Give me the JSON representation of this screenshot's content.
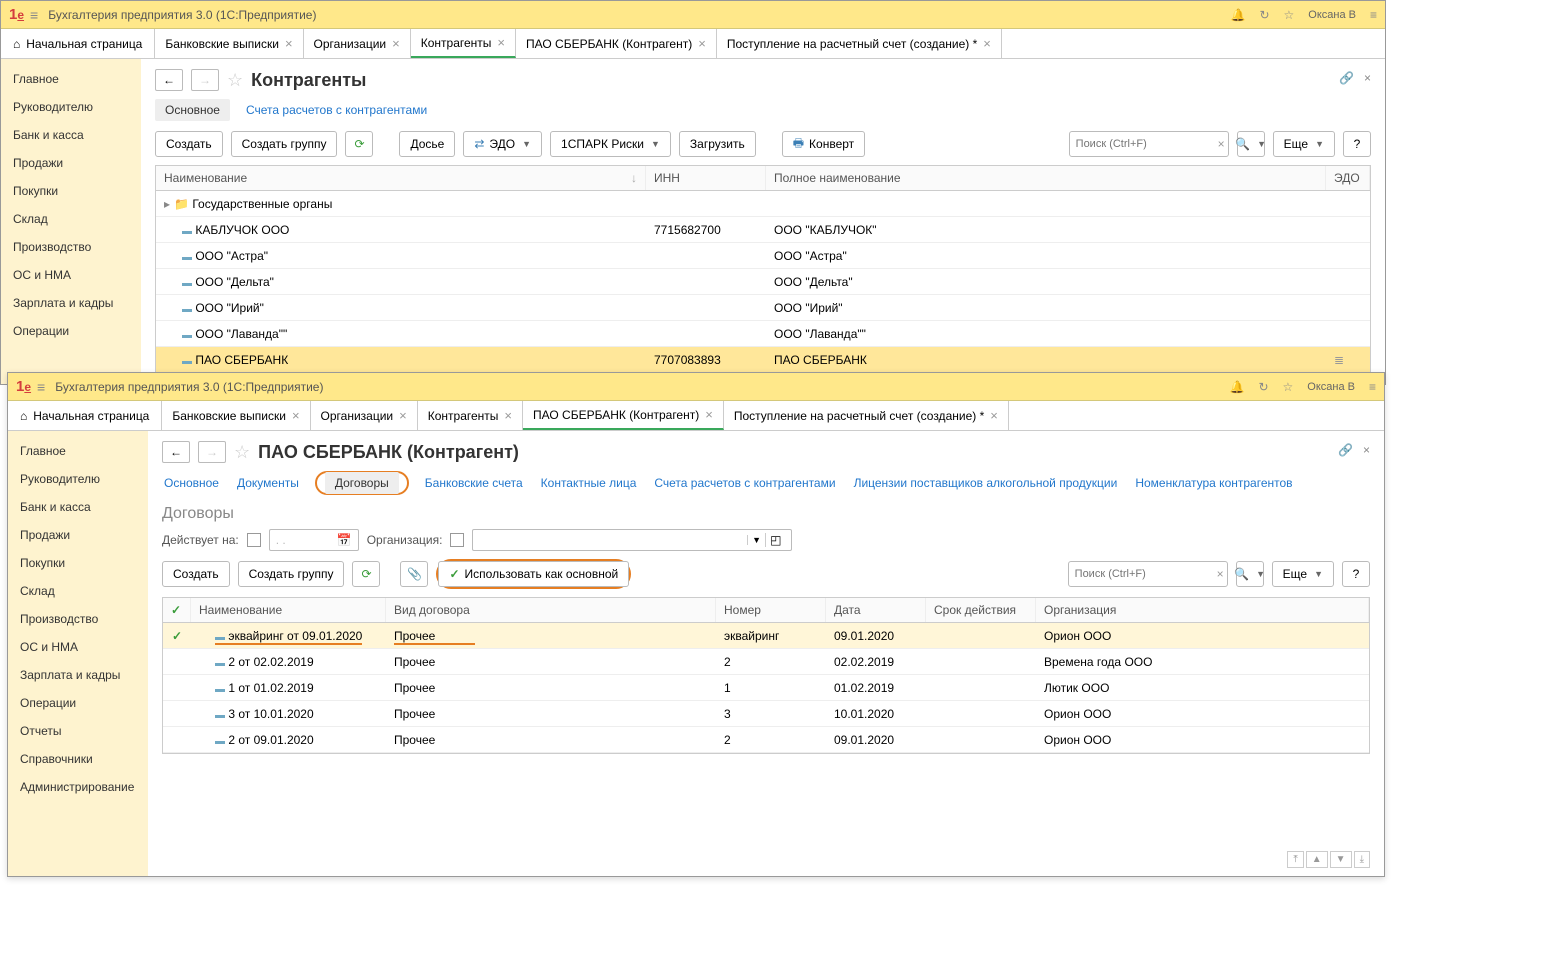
{
  "app": {
    "title": "Бухгалтерия предприятия 3.0  (1С:Предприятие)",
    "user": "Оксана В"
  },
  "w1": {
    "tabs": {
      "home": "Начальная страница",
      "t1": "Банковские выписки",
      "t2": "Организации",
      "t3": "Контрагенты",
      "t4": "ПАО СБЕРБАНК (Контрагент)",
      "t5": "Поступление на расчетный счет (создание) *"
    },
    "sidebar": [
      "Главное",
      "Руководителю",
      "Банк и касса",
      "Продажи",
      "Покупки",
      "Склад",
      "Производство",
      "ОС и НМА",
      "Зарплата и кадры",
      "Операции"
    ],
    "page_title": "Контрагенты",
    "subtabs": {
      "main": "Основное",
      "accounts": "Счета расчетов с контрагентами"
    },
    "toolbar": {
      "create": "Создать",
      "create_group": "Создать группу",
      "dossier": "Досье",
      "edo": "ЭДО",
      "spark": "1СПАРК Риски",
      "load": "Загрузить",
      "envelope": "Конверт",
      "more": "Еще",
      "search_ph": "Поиск (Ctrl+F)"
    },
    "table": {
      "headers": {
        "name": "Наименование",
        "inn": "ИНН",
        "fullname": "Полное наименование",
        "edo": "ЭДО"
      },
      "rows": [
        {
          "type": "folder",
          "name": "Государственные органы",
          "inn": "",
          "fullname": ""
        },
        {
          "type": "item",
          "name": "КАБЛУЧОК ООО",
          "inn": "7715682700",
          "fullname": "ООО \"КАБЛУЧОК\""
        },
        {
          "type": "item",
          "name": "ООО \"Астра\"",
          "inn": "",
          "fullname": "ООО \"Астра\""
        },
        {
          "type": "item",
          "name": "ООО \"Дельта\"",
          "inn": "",
          "fullname": "ООО \"Дельта\""
        },
        {
          "type": "item",
          "name": "ООО \"Ирий\"",
          "inn": "",
          "fullname": "ООО \"Ирий\""
        },
        {
          "type": "item",
          "name": "ООО \"Лаванда\"\"",
          "inn": "",
          "fullname": "ООО \"Лаванда\"\""
        },
        {
          "type": "item",
          "name": "ПАО СБЕРБАНК",
          "inn": "7707083893",
          "fullname": "ПАО СБЕРБАНК",
          "selected": true
        }
      ]
    }
  },
  "w2": {
    "tabs": {
      "home": "Начальная страница",
      "t1": "Банковские выписки",
      "t2": "Организации",
      "t3": "Контрагенты",
      "t4": "ПАО СБЕРБАНК (Контрагент)",
      "t5": "Поступление на расчетный счет (создание) *"
    },
    "sidebar": [
      "Главное",
      "Руководителю",
      "Банк и касса",
      "Продажи",
      "Покупки",
      "Склад",
      "Производство",
      "ОС и НМА",
      "Зарплата и кадры",
      "Операции",
      "Отчеты",
      "Справочники",
      "Администрирование"
    ],
    "page_title": "ПАО СБЕРБАНК (Контрагент)",
    "subtabs": [
      "Основное",
      "Документы",
      "Договоры",
      "Банковские счета",
      "Контактные лица",
      "Счета расчетов с контрагентами",
      "Лицензии поставщиков алкогольной продукции",
      "Номенклатура контрагентов"
    ],
    "section": "Договоры",
    "filters": {
      "date_label": "Действует на:",
      "date_ph": ". .",
      "org_label": "Организация:"
    },
    "toolbar": {
      "create": "Создать",
      "create_group": "Создать группу",
      "use_main": "Использовать как основной",
      "more": "Еще",
      "search_ph": "Поиск (Ctrl+F)"
    },
    "table": {
      "headers": {
        "name": "Наименование",
        "type": "Вид договора",
        "num": "Номер",
        "date": "Дата",
        "valid": "Срок действия",
        "org": "Организация"
      },
      "rows": [
        {
          "name": "эквайринг от 09.01.2020",
          "type": "Прочее",
          "num": "эквайринг",
          "date": "09.01.2020",
          "valid": "",
          "org": "Орион ООО",
          "main": true,
          "sel": true
        },
        {
          "name": "2 от 02.02.2019",
          "type": "Прочее",
          "num": "2",
          "date": "02.02.2019",
          "valid": "",
          "org": "Времена года ООО"
        },
        {
          "name": "1 от 01.02.2019",
          "type": "Прочее",
          "num": "1",
          "date": "01.02.2019",
          "valid": "",
          "org": "Лютик ООО"
        },
        {
          "name": "3 от 10.01.2020",
          "type": "Прочее",
          "num": "3",
          "date": "10.01.2020",
          "valid": "",
          "org": "Орион ООО"
        },
        {
          "name": "2 от 09.01.2020",
          "type": "Прочее",
          "num": "2",
          "date": "09.01.2020",
          "valid": "",
          "org": "Орион ООО"
        }
      ]
    }
  }
}
